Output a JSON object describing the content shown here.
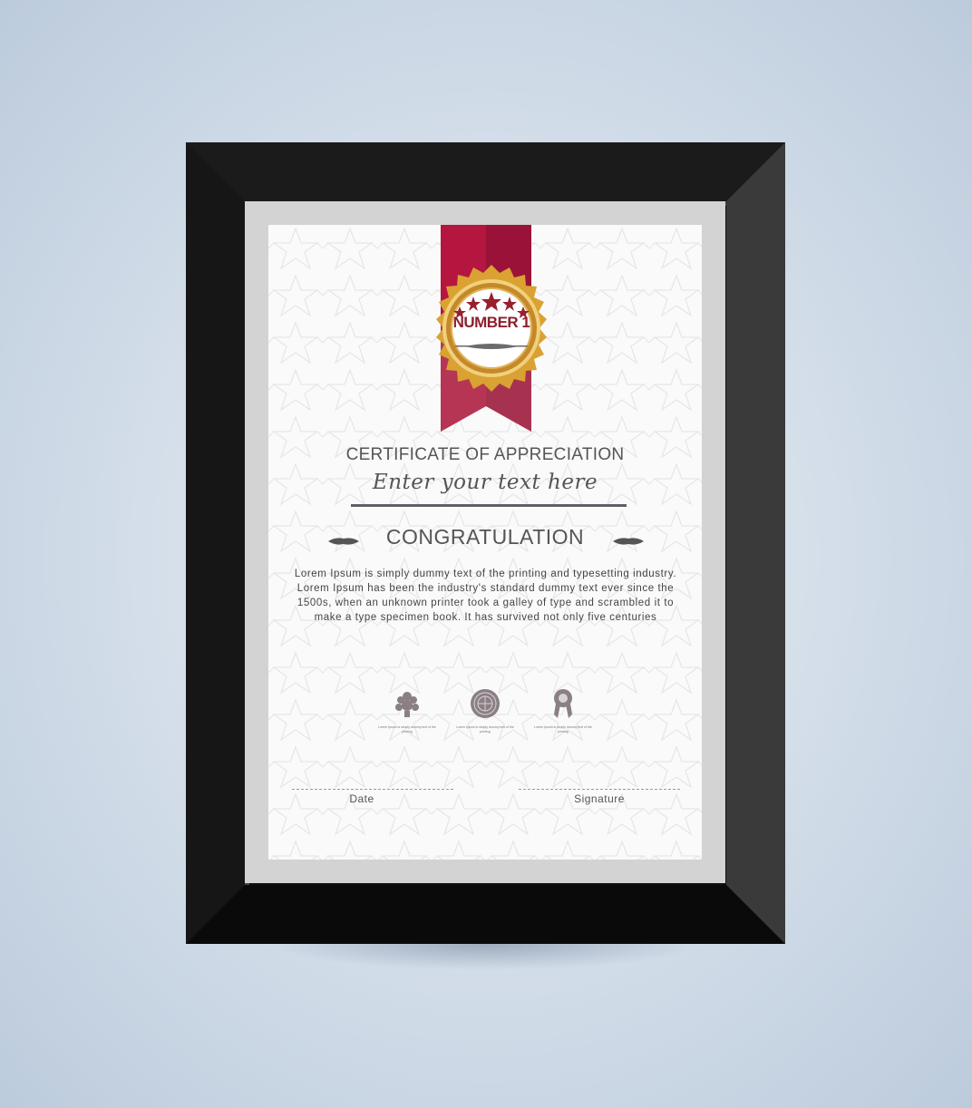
{
  "badge": {
    "label": "NUMBER 1"
  },
  "certificate": {
    "title": "CERTIFICATE OF APPRECIATION",
    "subtitle": "Enter your text here",
    "heading": "CONGRATULATION",
    "body": "Lorem Ipsum is simply dummy text of the printing and typesetting industry. Lorem Ipsum has been the industry's standard dummy text ever since the 1500s, when an unknown printer took a galley of type and scrambled it to make a type specimen book. It has survived not only five centuries"
  },
  "awards": [
    {
      "icon": "laurel-icon",
      "caption": "Lorem Ipsum is simply dummy text of the printing"
    },
    {
      "icon": "seal-icon",
      "caption": "Lorem Ipsum is simply dummy text of the printing"
    },
    {
      "icon": "rosette-icon",
      "caption": "Lorem Ipsum is simply dummy text of the printing"
    }
  ],
  "footer": {
    "date_label": "Date",
    "signature_label": "Signature"
  },
  "colors": {
    "ribbon": "#b5163f",
    "gold": "#d9a233",
    "frame": "#111111",
    "mat": "#d3d3d3"
  }
}
